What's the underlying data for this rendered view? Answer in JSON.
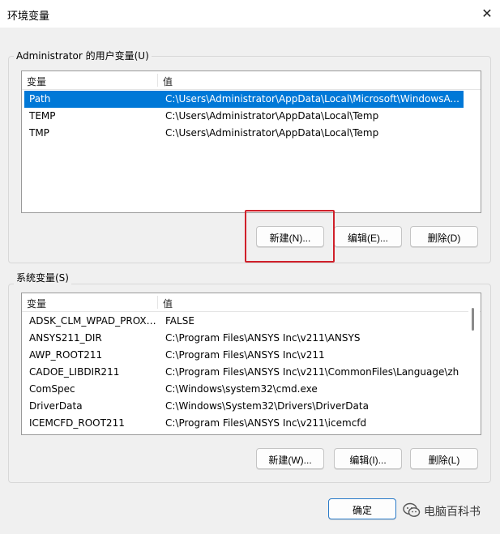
{
  "window": {
    "title": "环境变量",
    "close_glyph": "✕"
  },
  "user_vars": {
    "group_label": "Administrator 的用户变量(U)",
    "columns": [
      "变量",
      "值"
    ],
    "rows": [
      {
        "name": "Path",
        "value": "C:\\Users\\Administrator\\AppData\\Local\\Microsoft\\WindowsA...",
        "selected": true
      },
      {
        "name": "TEMP",
        "value": "C:\\Users\\Administrator\\AppData\\Local\\Temp",
        "selected": false
      },
      {
        "name": "TMP",
        "value": "C:\\Users\\Administrator\\AppData\\Local\\Temp",
        "selected": false
      }
    ],
    "buttons": {
      "new": "新建(N)...",
      "edit": "编辑(E)...",
      "delete": "删除(D)"
    }
  },
  "system_vars": {
    "group_label": "系统变量(S)",
    "columns": [
      "变量",
      "值"
    ],
    "rows": [
      {
        "name": "ADSK_CLM_WPAD_PROXY...",
        "value": "FALSE",
        "selected": false
      },
      {
        "name": "ANSYS211_DIR",
        "value": "C:\\Program Files\\ANSYS Inc\\v211\\ANSYS",
        "selected": false
      },
      {
        "name": "AWP_ROOT211",
        "value": "C:\\Program Files\\ANSYS Inc\\v211",
        "selected": false
      },
      {
        "name": "CADOE_LIBDIR211",
        "value": "C:\\Program Files\\ANSYS Inc\\v211\\CommonFiles\\Language\\zh",
        "selected": false
      },
      {
        "name": "ComSpec",
        "value": "C:\\Windows\\system32\\cmd.exe",
        "selected": false
      },
      {
        "name": "DriverData",
        "value": "C:\\Windows\\System32\\Drivers\\DriverData",
        "selected": false
      },
      {
        "name": "ICEMCFD_ROOT211",
        "value": "C:\\Program Files\\ANSYS Inc\\v211\\icemcfd",
        "selected": false
      }
    ],
    "buttons": {
      "new": "新建(W)...",
      "edit": "编辑(I)...",
      "delete": "删除(L)"
    }
  },
  "footer": {
    "ok": "确定"
  },
  "watermark": {
    "text": "电脑百科书",
    "icon": "wechat-icon"
  },
  "colors": {
    "selection": "#0078d7",
    "highlight_box": "#d0202a",
    "primary_border": "#2a7bc9"
  }
}
